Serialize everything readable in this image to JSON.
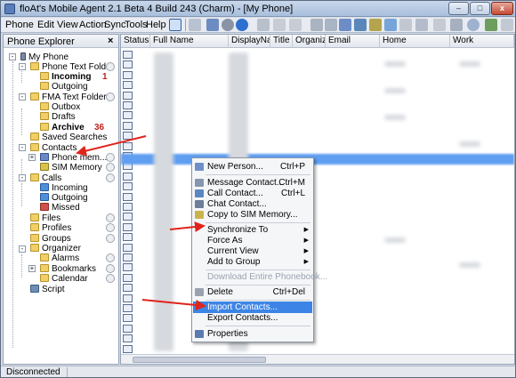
{
  "window": {
    "title": "floAt's Mobile Agent 2.1 Beta 4 Build 243 (Charm) - [My Phone]",
    "min_label": "–",
    "max_label": "□",
    "close_label": "x"
  },
  "menu": [
    "Phone",
    "Edit",
    "View",
    "Action",
    "Sync",
    "Tools",
    "Help"
  ],
  "explorer": {
    "title": "Phone Explorer",
    "close_label": "×",
    "nodes": [
      {
        "label": "My Phone",
        "icon": "phone-icon"
      },
      {
        "label": "Phone Text Fold...",
        "icon": "folder-icon"
      },
      {
        "label": "Incoming",
        "icon": "folder-icon",
        "count": "1"
      },
      {
        "label": "Outgoing",
        "icon": "folder-icon"
      },
      {
        "label": "FMA Text Folders",
        "icon": "folder-icon"
      },
      {
        "label": "Outbox",
        "icon": "folder-icon"
      },
      {
        "label": "Drafts",
        "icon": "folder-icon"
      },
      {
        "label": "Archive",
        "icon": "folder-icon",
        "count": "36"
      },
      {
        "label": "Saved Searches",
        "icon": "folder-icon"
      },
      {
        "label": "Contacts",
        "icon": "contacts-icon"
      },
      {
        "label": "Phone mem...",
        "icon": "contacts-icon"
      },
      {
        "label": "SIM Memory",
        "icon": "sim-icon"
      },
      {
        "label": "Calls",
        "icon": "folder-icon"
      },
      {
        "label": "Incoming",
        "icon": "call-icon"
      },
      {
        "label": "Outgoing",
        "icon": "call-icon"
      },
      {
        "label": "Missed",
        "icon": "missed-call-icon"
      },
      {
        "label": "Files",
        "icon": "folder-icon"
      },
      {
        "label": "Profiles",
        "icon": "folder-icon"
      },
      {
        "label": "Groups",
        "icon": "folder-icon"
      },
      {
        "label": "Organizer",
        "icon": "folder-icon"
      },
      {
        "label": "Alarms",
        "icon": "folder-icon"
      },
      {
        "label": "Bookmarks",
        "icon": "folder-icon"
      },
      {
        "label": "Calendar",
        "icon": "folder-icon"
      },
      {
        "label": "Script",
        "icon": "script-icon"
      }
    ]
  },
  "list": {
    "columns": [
      "Status",
      "Full Name",
      "DisplayNa...",
      "Title",
      "Organiz...",
      "Email",
      "Home",
      "Work"
    ]
  },
  "context_menu": {
    "items": [
      {
        "label": "New Person...",
        "shortcut": "Ctrl+P"
      },
      {
        "label": "Message Contact...",
        "shortcut": "Ctrl+M"
      },
      {
        "label": "Call Contact...",
        "shortcut": "Ctrl+L"
      },
      {
        "label": "Chat Contact...",
        "shortcut": ""
      },
      {
        "label": "Copy to SIM Memory...",
        "shortcut": ""
      },
      {
        "label": "Synchronize To",
        "shortcut": ""
      },
      {
        "label": "Force As",
        "shortcut": ""
      },
      {
        "label": "Current View",
        "shortcut": ""
      },
      {
        "label": "Add to Group",
        "shortcut": ""
      },
      {
        "label": "Download Entire Phonebook...",
        "shortcut": ""
      },
      {
        "label": "Delete",
        "shortcut": "Ctrl+Del"
      },
      {
        "label": "Import Contacts...",
        "shortcut": ""
      },
      {
        "label": "Export Contacts...",
        "shortcut": ""
      },
      {
        "label": "Properties",
        "shortcut": ""
      }
    ]
  },
  "status": {
    "text": "Disconnected"
  },
  "colors": {
    "selection": "#3c85e6",
    "annotation_arrow": "#e0241b",
    "count_text": "#c0201c"
  }
}
